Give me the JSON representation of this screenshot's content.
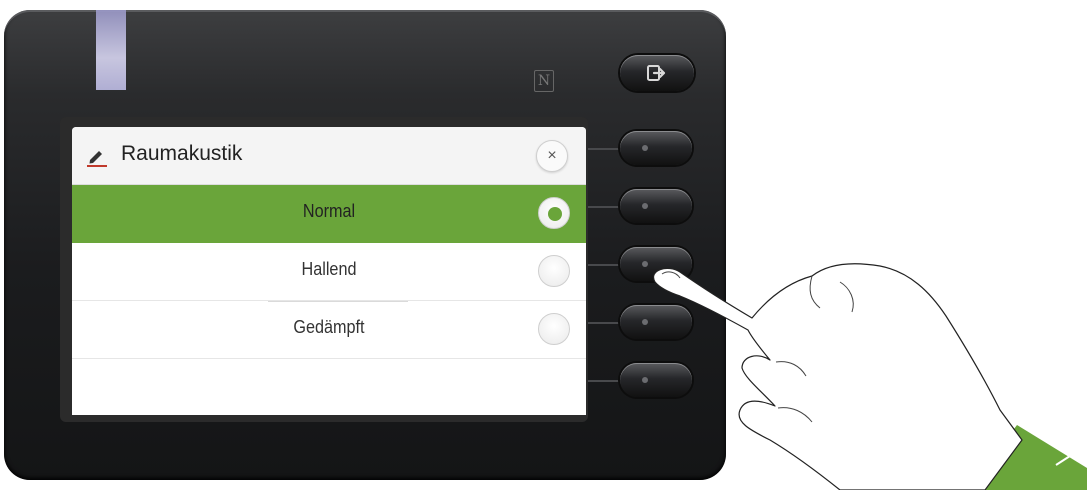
{
  "dialog": {
    "title": "Raumakustik",
    "title_icon": "pencil-edit-icon",
    "close_icon": "close-x-icon",
    "close_glyph": "×"
  },
  "options": [
    {
      "label": "Normal",
      "selected": true
    },
    {
      "label": "Hallend",
      "selected": false
    },
    {
      "label": "Gedämpft",
      "selected": false
    }
  ],
  "device": {
    "nfc_glyph": "N",
    "exit_key_icon": "exit-arrow-icon"
  },
  "colors": {
    "accent_green": "#6aa53a",
    "led_lavender": "#c9c7ea",
    "title_icon_underline": "#c0392b"
  }
}
